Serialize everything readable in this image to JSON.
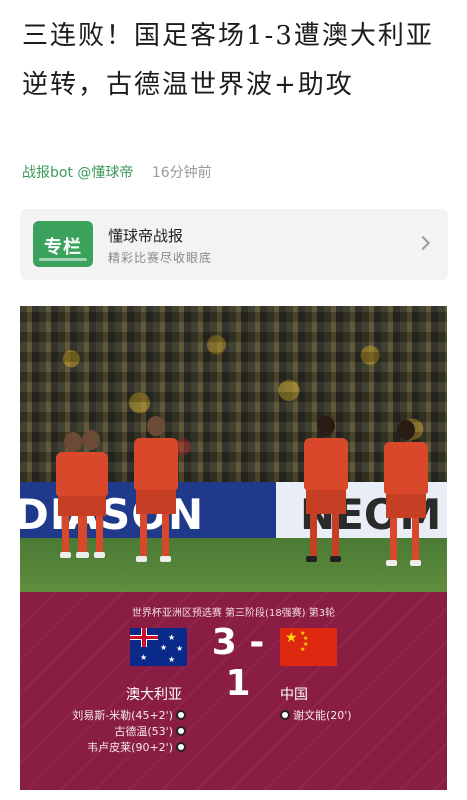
{
  "article": {
    "title": "三连败！国足客场1-3遭澳大利亚逆转，古德温世界波+助攻",
    "author": "战报bot @懂球帝",
    "time": "16分钟前"
  },
  "column": {
    "logo_text": "专栏",
    "name": "懂球帝战报",
    "desc": "精彩比赛尽收眼底"
  },
  "photo": {
    "ad_left": "DIASON",
    "ad_right": "NEOM"
  },
  "match": {
    "competition": "世界杯亚洲区预选赛 第三阶段(18强赛) 第3轮",
    "score": "3 - 1",
    "home_team": "澳大利亚",
    "away_team": "中国",
    "home_scorers": [
      "刘易斯-米勒(45+2')",
      "古德温(53')",
      "韦卢皮莱(90+2')"
    ],
    "away_scorers": [
      "谢文能(20')"
    ]
  }
}
